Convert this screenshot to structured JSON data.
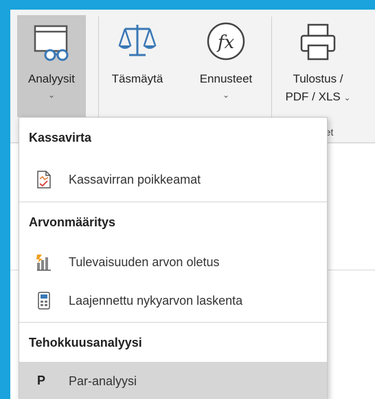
{
  "ribbon": {
    "analysis": {
      "label": "Analyysit",
      "chevron": "⌄"
    },
    "reconcile": {
      "label": "Täsmäytä"
    },
    "forecast": {
      "label": "Ennusteet",
      "chevron": "⌄"
    },
    "print": {
      "line1": "Tulostus /",
      "line2": "PDF / XLS",
      "chevron": "⌄"
    },
    "group_caption": "steet"
  },
  "menu": {
    "sections": [
      {
        "header": "Kassavirta"
      },
      {
        "header": "Arvonmääritys"
      },
      {
        "header": "Tehokkuusanalyysi"
      }
    ],
    "items": [
      {
        "label": "Kassavirran poikkeamat",
        "icon": "cashflow-doc-icon"
      },
      {
        "label": "Tulevaisuuden arvon oletus",
        "icon": "future-value-icon"
      },
      {
        "label": "Laajennettu nykyarvon laskenta",
        "icon": "calculator-icon"
      },
      {
        "label": "Par-analyysi",
        "icon": "p-letter-icon",
        "icon_text": "P"
      }
    ]
  },
  "colors": {
    "frame": "#1aa3dc",
    "selected": "#c8c8c8",
    "hover": "#d6d6d6"
  }
}
